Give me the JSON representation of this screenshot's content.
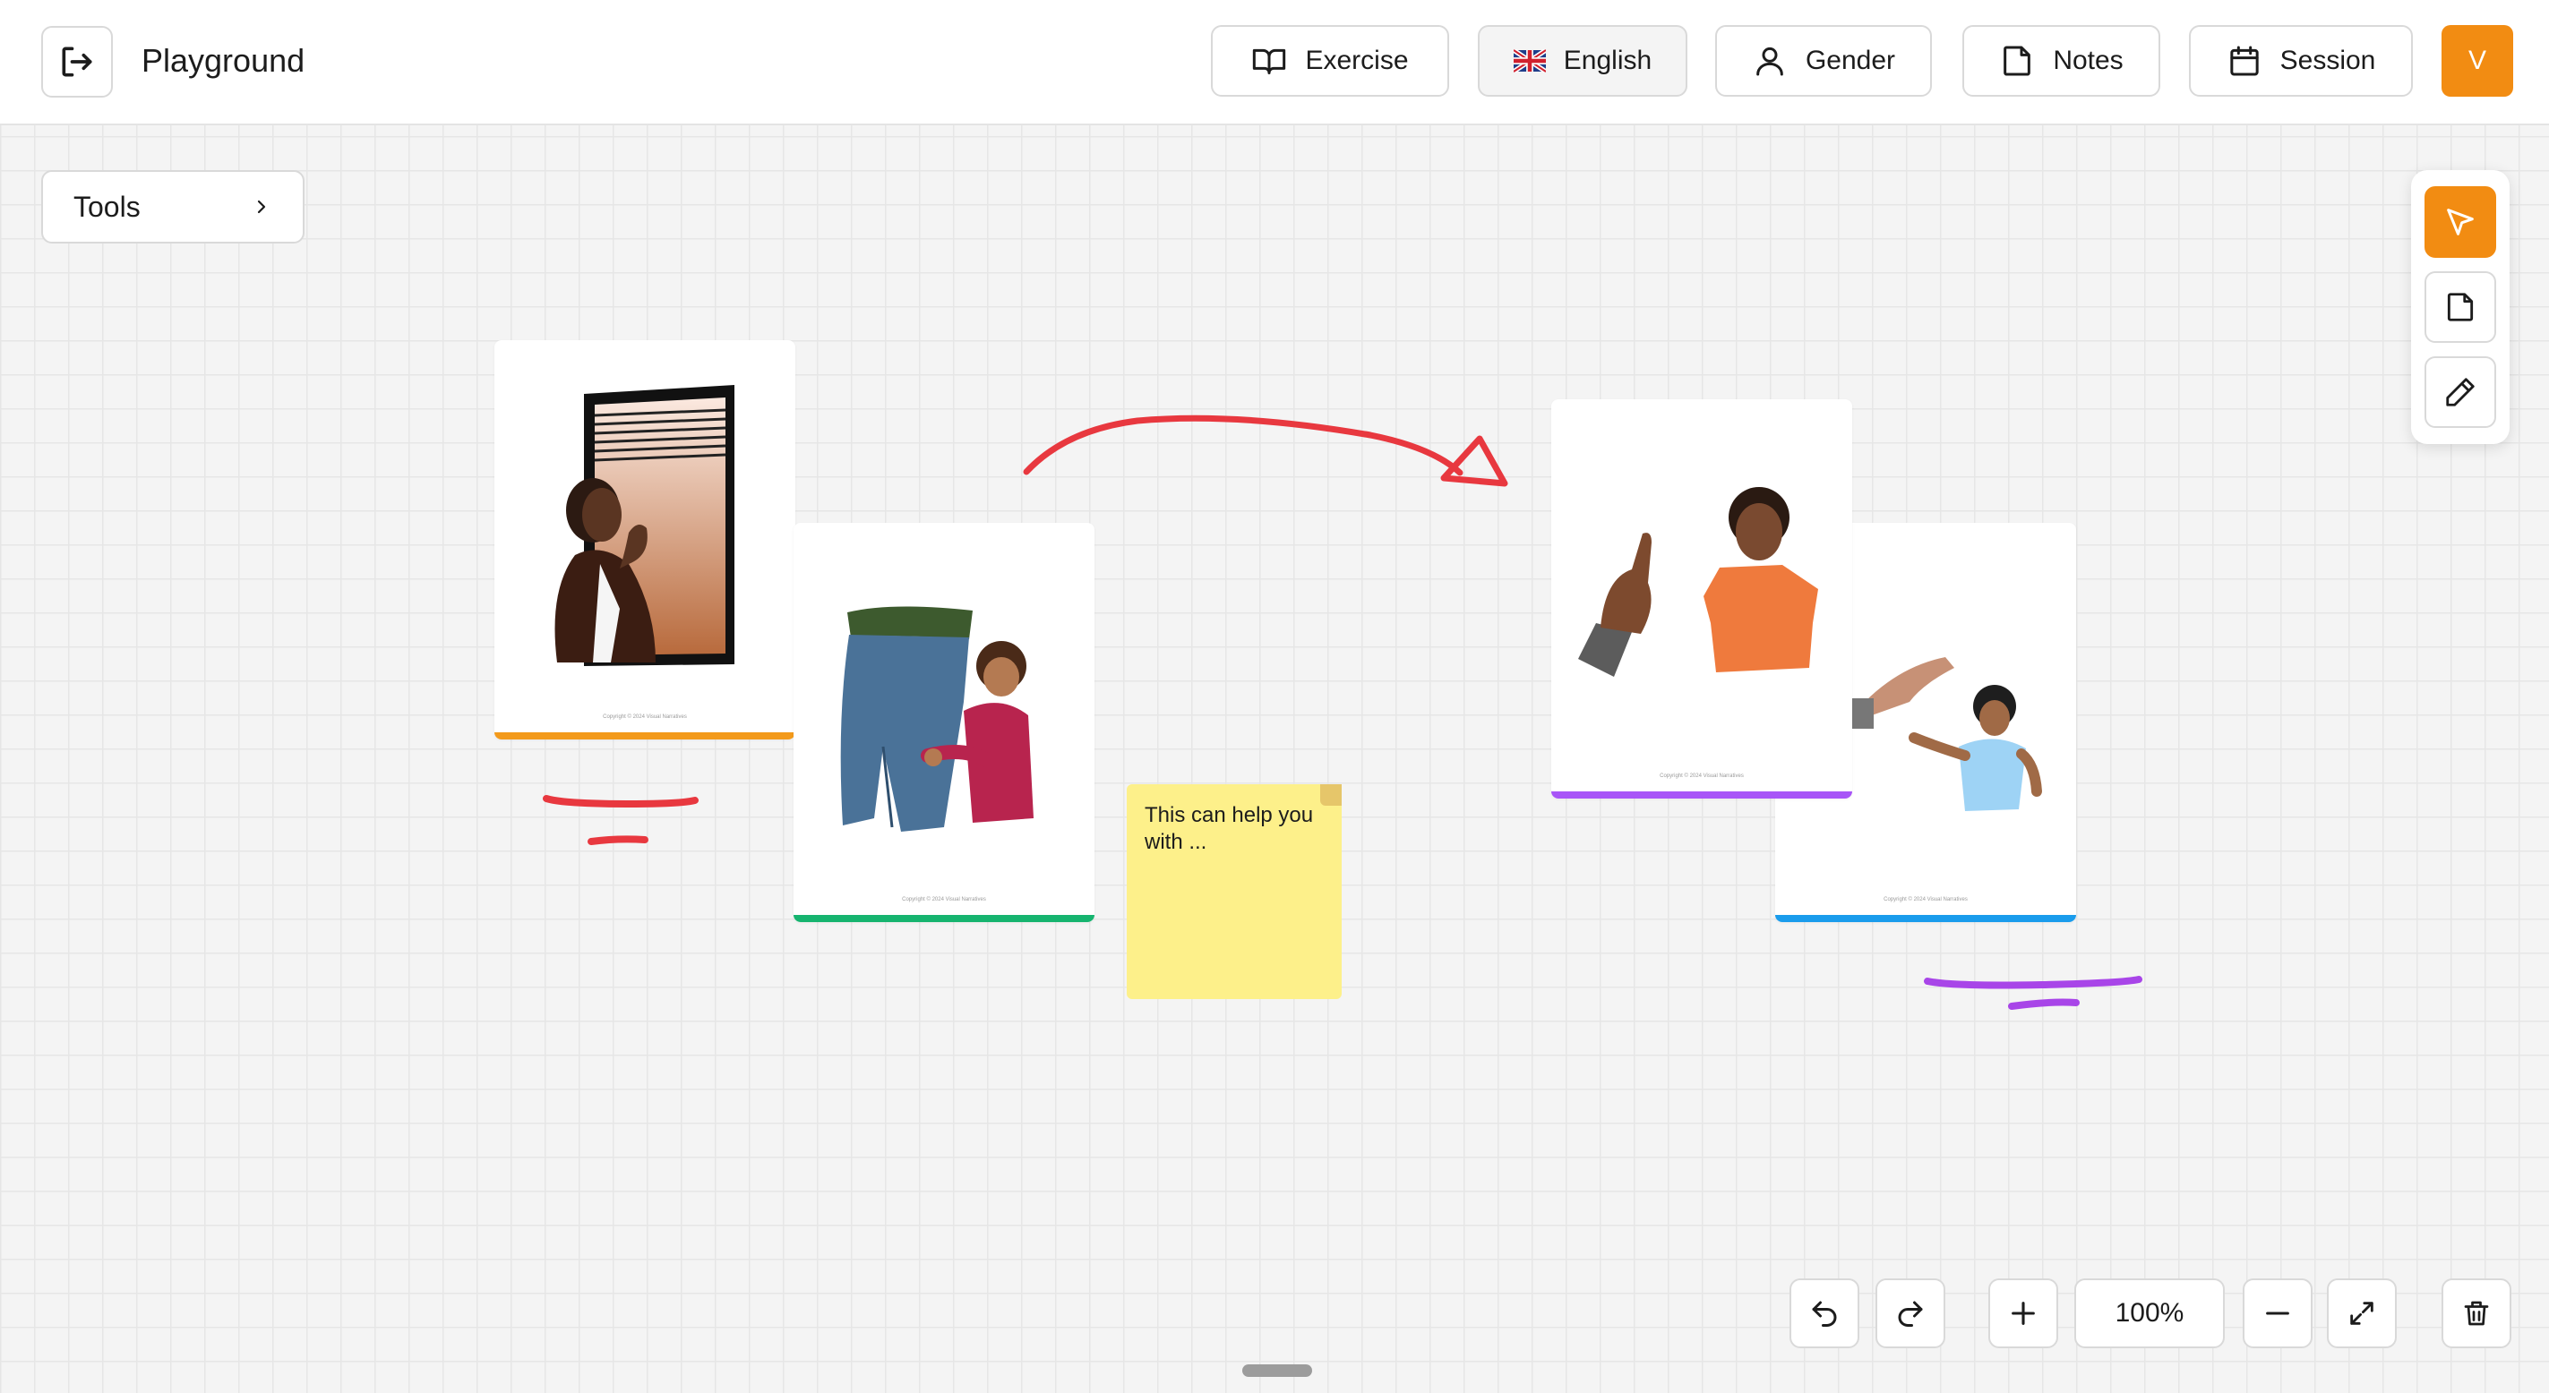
{
  "header": {
    "title": "Playground",
    "nav": {
      "exercise": "Exercise",
      "language": "English",
      "gender": "Gender",
      "notes": "Notes",
      "session": "Session"
    },
    "avatar_initial": "V"
  },
  "tools": {
    "label": "Tools"
  },
  "canvas": {
    "cards": [
      {
        "accent": "#f39a1b",
        "copyright": "Copyright © 2024 Visual Narratives"
      },
      {
        "accent": "#16b46f",
        "copyright": "Copyright © 2024 Visual Narratives"
      },
      {
        "accent": "#a855f7",
        "copyright": "Copyright © 2024 Visual Narratives"
      },
      {
        "accent": "#1a9cec",
        "copyright": "Copyright © 2024 Visual Narratives"
      }
    ],
    "sticky_note": {
      "text": "This can help you with ..."
    },
    "ink_colors": {
      "red": "#e8383f",
      "purple": "#a845e8"
    }
  },
  "controls": {
    "zoom": "100%"
  },
  "colors": {
    "accent": "#f28c12"
  }
}
